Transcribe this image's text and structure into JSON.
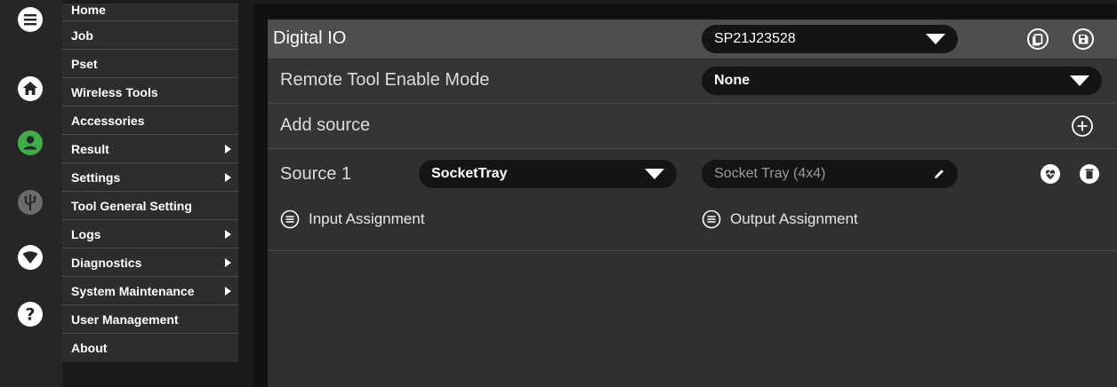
{
  "rail": {
    "icons": [
      {
        "name": "menu-icon"
      },
      {
        "name": "home-icon"
      },
      {
        "name": "user-icon"
      },
      {
        "name": "usb-icon"
      },
      {
        "name": "wifi-icon"
      },
      {
        "name": "help-icon"
      }
    ],
    "colors": {
      "user_active": "#3fae49"
    }
  },
  "menu": {
    "items": [
      {
        "label": "Home",
        "has_submenu": false
      },
      {
        "label": "Job",
        "has_submenu": false
      },
      {
        "label": "Pset",
        "has_submenu": false
      },
      {
        "label": "Wireless Tools",
        "has_submenu": false
      },
      {
        "label": "Accessories",
        "has_submenu": false
      },
      {
        "label": "Result",
        "has_submenu": true
      },
      {
        "label": "Settings",
        "has_submenu": true
      },
      {
        "label": "Tool General Setting",
        "has_submenu": false
      },
      {
        "label": "Logs",
        "has_submenu": true
      },
      {
        "label": "Diagnostics",
        "has_submenu": true
      },
      {
        "label": "System Maintenance",
        "has_submenu": true
      },
      {
        "label": "User Management",
        "has_submenu": false
      },
      {
        "label": "About",
        "has_submenu": false
      }
    ]
  },
  "panel": {
    "title": "Digital IO",
    "device_select": "SP21J23528",
    "header_icons": [
      "copy-icon",
      "save-icon"
    ],
    "remote_tool": {
      "label": "Remote Tool Enable Mode",
      "value": "None"
    },
    "add_source": {
      "label": "Add source",
      "icon": "add-circle-icon"
    },
    "source": {
      "label": "Source 1",
      "type_value": "SocketTray",
      "name_value": "Socket Tray (4x4)",
      "input_assignment": "Input Assignment",
      "output_assignment": "Output Assignment"
    }
  }
}
